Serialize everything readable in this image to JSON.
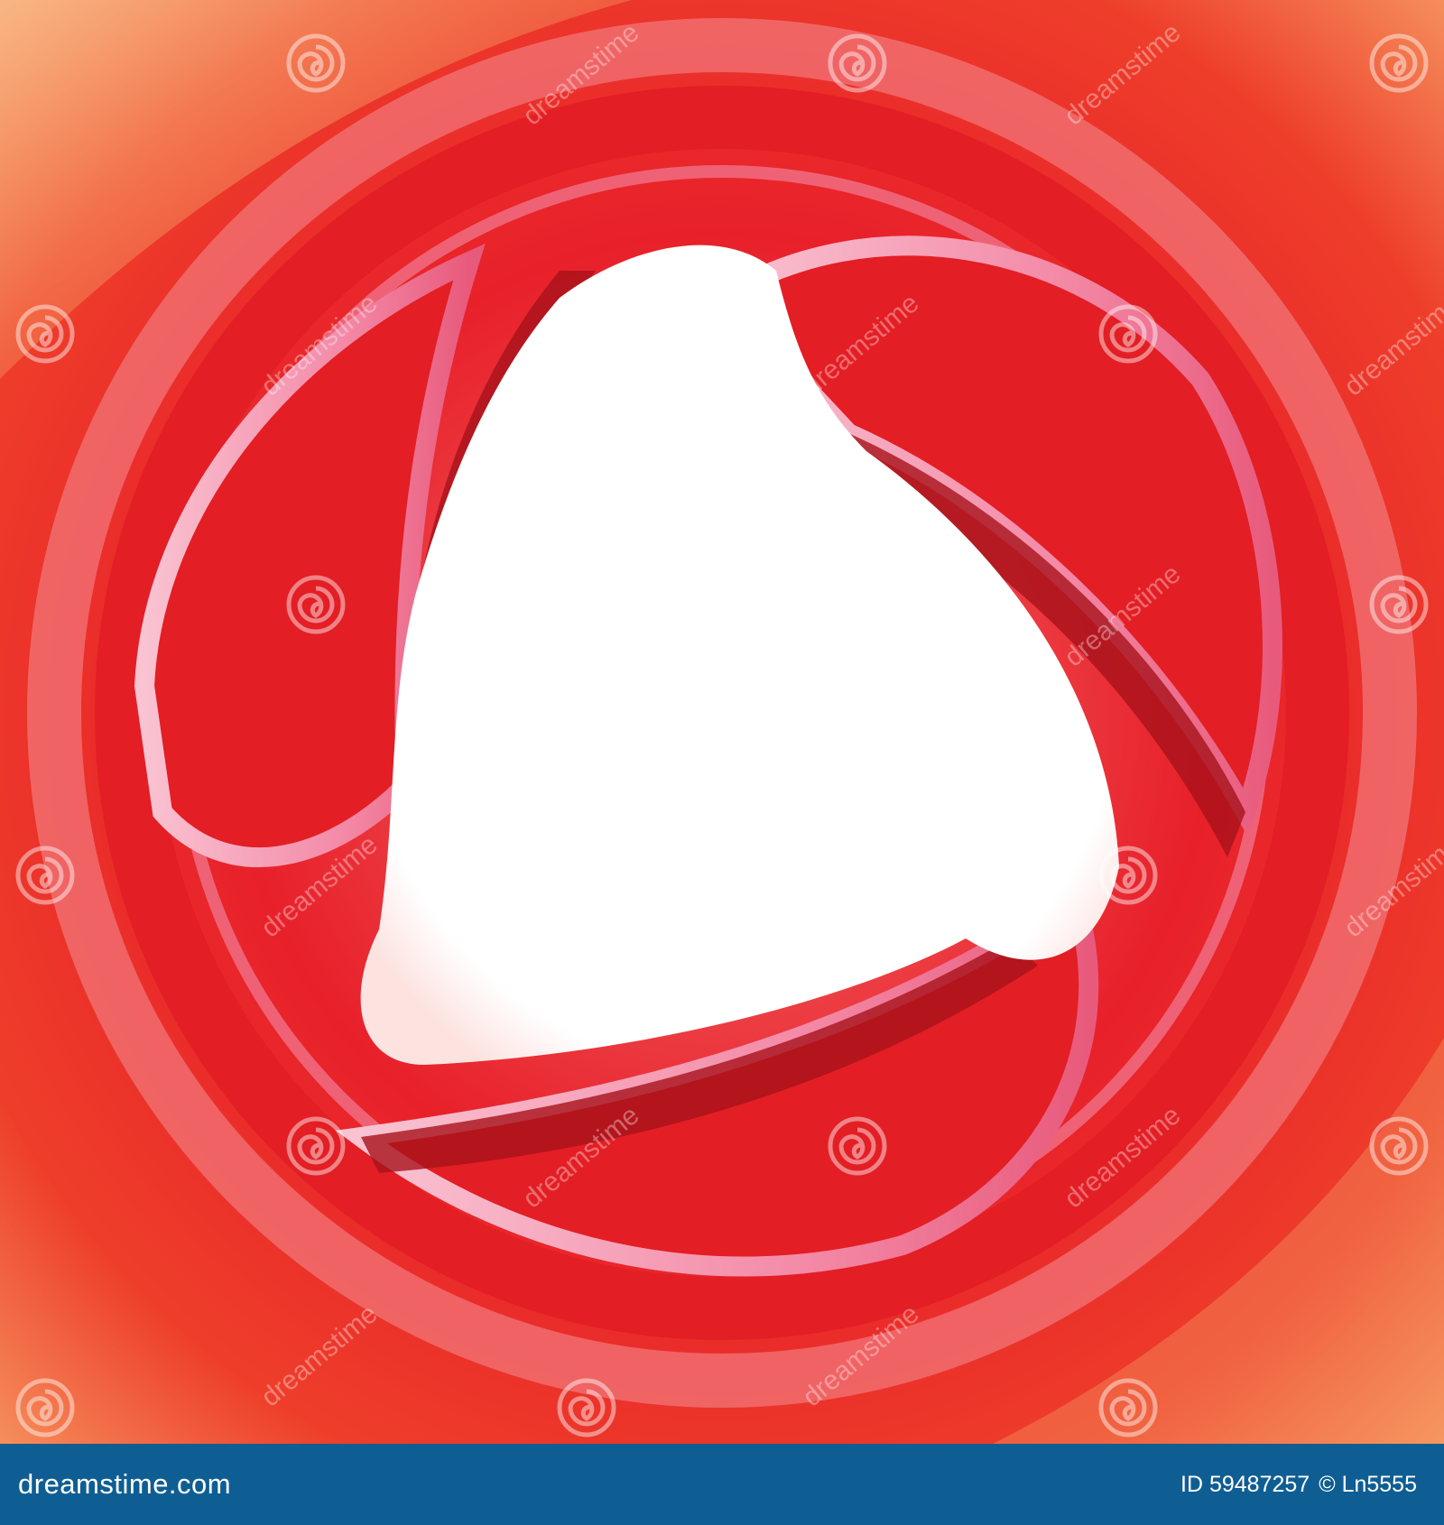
{
  "image": {
    "subject": "abstract red swirl with a white rounded triangular center",
    "colors": {
      "primary_red": "#E31E24",
      "deep_red": "#A8121A",
      "pink": "#F48BA8",
      "light_pink": "#F9C3D2",
      "orange": "#F26A2C",
      "peach": "#F7B98C",
      "center": "#FFFFFF"
    }
  },
  "watermark": {
    "word": "dreamstime",
    "icon": "spiral-logo-icon"
  },
  "footer": {
    "site": "dreamstime.com",
    "image_id": "ID 59487257",
    "author": "© Ln5555",
    "background": "#0F5E93"
  }
}
